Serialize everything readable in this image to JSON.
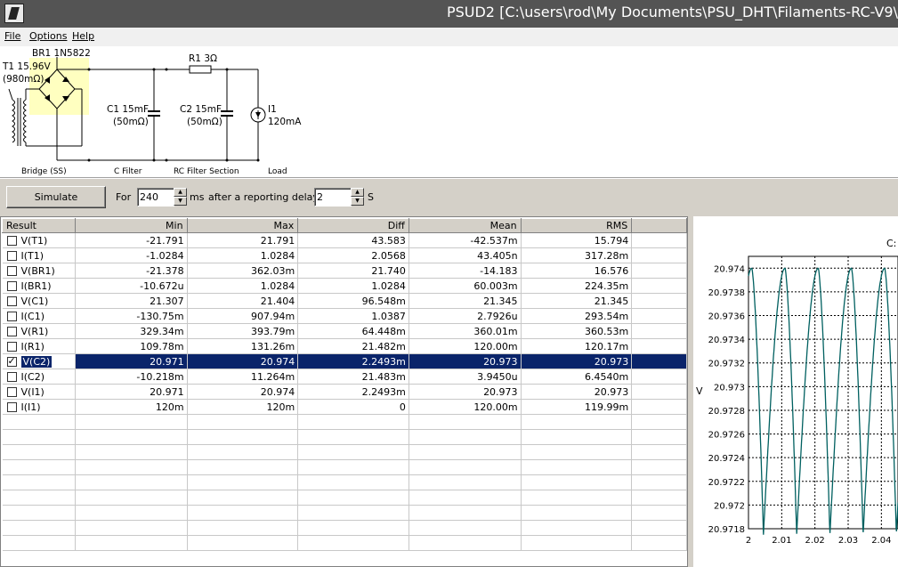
{
  "window": {
    "title": "PSUD2 [C:\\users\\rod\\My Documents\\PSU_DHT\\Filaments-RC-V9\\"
  },
  "menu": {
    "file": "File",
    "options": "Options",
    "help": "Help"
  },
  "schematic": {
    "transformer_label": "T1 15.96V",
    "transformer_res": "(980mΩ)",
    "bridge_label": "BR1 1N5822",
    "c1_label": "C1 15mF",
    "c1_esr": "(50mΩ)",
    "r1_label": "R1 3Ω",
    "c2_label": "C2 15mF",
    "c2_esr": "(50mΩ)",
    "load_label": "I1",
    "load_value": "120mA",
    "section_bridge": "Bridge (SS)",
    "section_cfilter": "C Filter",
    "section_rcfilter": "RC Filter Section",
    "section_load": "Load",
    "colors": {
      "bridge_highlight": "#ffffc0"
    }
  },
  "controls": {
    "simulate_label": "Simulate",
    "for_label": "For",
    "duration_value": "240",
    "duration_unit": "ms",
    "delay_label": "after a reporting delay of",
    "delay_value": "2",
    "delay_unit": "S"
  },
  "results": {
    "columns": [
      "Result",
      "Min",
      "Max",
      "Diff",
      "Mean",
      "RMS"
    ],
    "rows": [
      {
        "name": "V(T1)",
        "checked": false,
        "min": "-21.791",
        "max": "21.791",
        "diff": "43.583",
        "mean": "-42.537m",
        "rms": "15.794"
      },
      {
        "name": "I(T1)",
        "checked": false,
        "min": "-1.0284",
        "max": "1.0284",
        "diff": "2.0568",
        "mean": "43.405n",
        "rms": "317.28m"
      },
      {
        "name": "V(BR1)",
        "checked": false,
        "min": "-21.378",
        "max": "362.03m",
        "diff": "21.740",
        "mean": "-14.183",
        "rms": "16.576"
      },
      {
        "name": "I(BR1)",
        "checked": false,
        "min": "-10.672u",
        "max": "1.0284",
        "diff": "1.0284",
        "mean": "60.003m",
        "rms": "224.35m"
      },
      {
        "name": "V(C1)",
        "checked": false,
        "min": "21.307",
        "max": "21.404",
        "diff": "96.548m",
        "mean": "21.345",
        "rms": "21.345"
      },
      {
        "name": "I(C1)",
        "checked": false,
        "min": "-130.75m",
        "max": "907.94m",
        "diff": "1.0387",
        "mean": "2.7926u",
        "rms": "293.54m"
      },
      {
        "name": "V(R1)",
        "checked": false,
        "min": "329.34m",
        "max": "393.79m",
        "diff": "64.448m",
        "mean": "360.01m",
        "rms": "360.53m"
      },
      {
        "name": "I(R1)",
        "checked": false,
        "min": "109.78m",
        "max": "131.26m",
        "diff": "21.482m",
        "mean": "120.00m",
        "rms": "120.17m"
      },
      {
        "name": "V(C2)",
        "checked": true,
        "selected": true,
        "min": "20.971",
        "max": "20.974",
        "diff": "2.2493m",
        "mean": "20.973",
        "rms": "20.973"
      },
      {
        "name": "I(C2)",
        "checked": false,
        "min": "-10.218m",
        "max": "11.264m",
        "diff": "21.483m",
        "mean": "3.9450u",
        "rms": "6.4540m"
      },
      {
        "name": "V(I1)",
        "checked": false,
        "min": "20.971",
        "max": "20.974",
        "diff": "2.2493m",
        "mean": "20.973",
        "rms": "20.973"
      },
      {
        "name": "I(I1)",
        "checked": false,
        "min": "120m",
        "max": "120m",
        "diff": "0",
        "mean": "120.00m",
        "rms": "119.99m"
      }
    ],
    "empty_rows": 9,
    "colors": {
      "selected_bg": "#0a246a"
    }
  },
  "chart_data": {
    "type": "line",
    "title": "C:",
    "ylabel": "V",
    "xlabel": "",
    "xlim": [
      2,
      2.045
    ],
    "ylim": [
      20.9718,
      20.9741
    ],
    "x_ticks": [
      "2",
      "2.01",
      "2.02",
      "2.03",
      "2.04"
    ],
    "y_ticks": [
      "20.974",
      "20.9738",
      "20.9736",
      "20.9734",
      "20.9732",
      "20.973",
      "20.9728",
      "20.9726",
      "20.9724",
      "20.9722",
      "20.972",
      "20.9718"
    ],
    "grid": true,
    "series": [
      {
        "period": 0.01,
        "max": 20.974,
        "min": 20.97175,
        "peaks_x": [
          2.001,
          2.011,
          2.021,
          2.031,
          2.041
        ],
        "troughs_x": [
          2.0045,
          2.0145,
          2.0245,
          2.0345,
          2.0445
        ],
        "color": "#006060"
      }
    ]
  }
}
